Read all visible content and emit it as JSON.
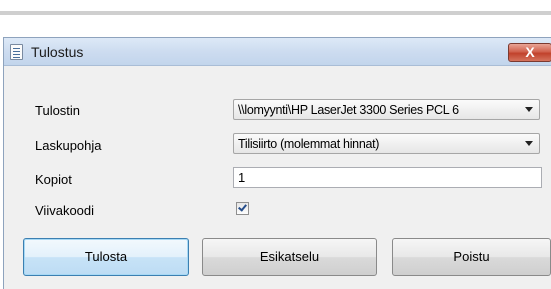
{
  "dialog": {
    "title": "Tulostus",
    "close_label": "X"
  },
  "fields": {
    "printer": {
      "label": "Tulostin",
      "value": "\\\\lomyynti\\HP LaserJet 3300 Series PCL 6"
    },
    "template": {
      "label": "Laskupohja",
      "value": "Tilisiirto (molemmat hinnat)"
    },
    "copies": {
      "label": "Kopiot",
      "value": "1"
    },
    "barcode": {
      "label": "Viivakoodi",
      "checked": true
    }
  },
  "buttons": {
    "print": "Tulosta",
    "preview": "Esikatselu",
    "exit": "Poistu"
  },
  "colors": {
    "close_button": "#c7442e",
    "default_button_border": "#3c7fb1"
  }
}
